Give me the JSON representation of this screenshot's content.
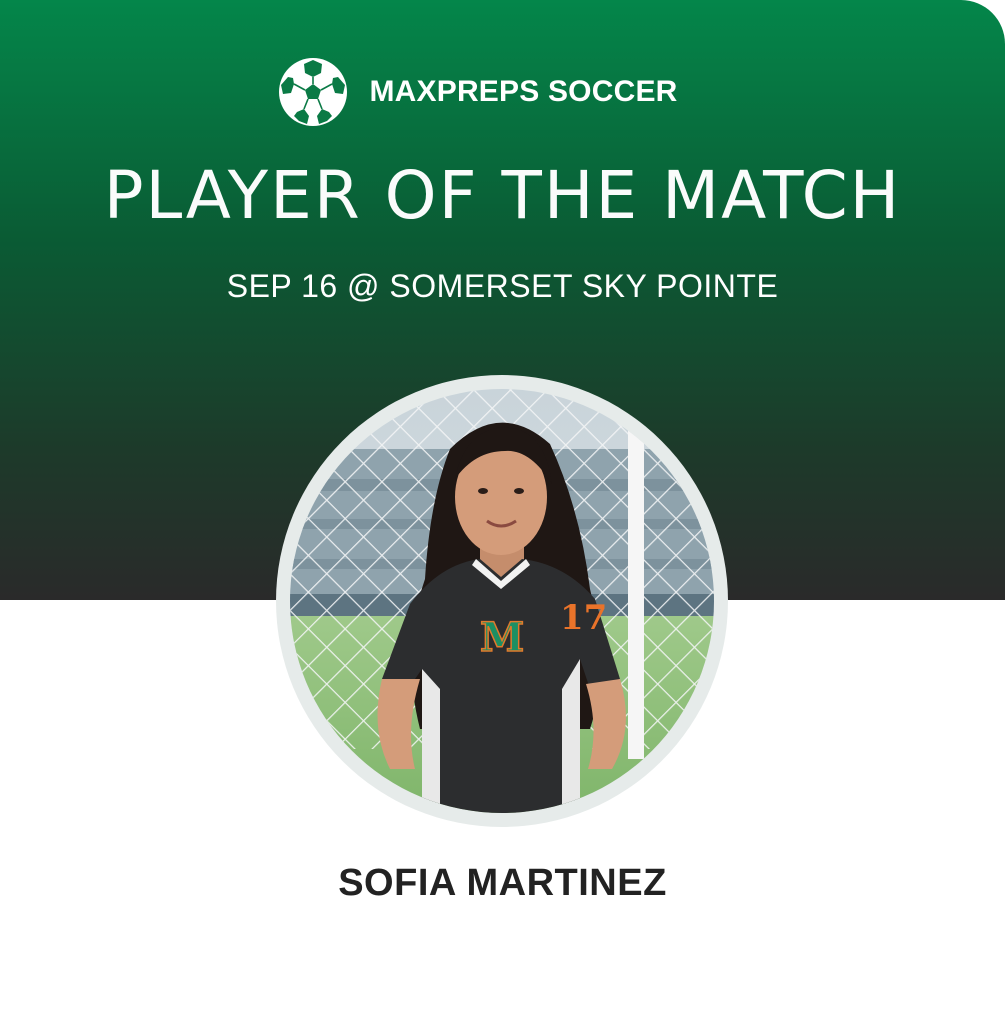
{
  "brand": {
    "name": "MAXPREPS SOCCER",
    "icon": "soccer-ball-icon"
  },
  "title": "PLAYER OF THE MATCH",
  "subtitle": "SEP 16 @ SOMERSET SKY POINTE",
  "player": {
    "name": "SOFIA MARTINEZ",
    "jersey_number": "17",
    "jersey_letter": "M"
  },
  "colors": {
    "header_top": "#04864a",
    "header_bottom": "#2a2a2a",
    "text_light": "#ffffff",
    "text_dark": "#222222",
    "photo_ring": "#e6ebea"
  }
}
